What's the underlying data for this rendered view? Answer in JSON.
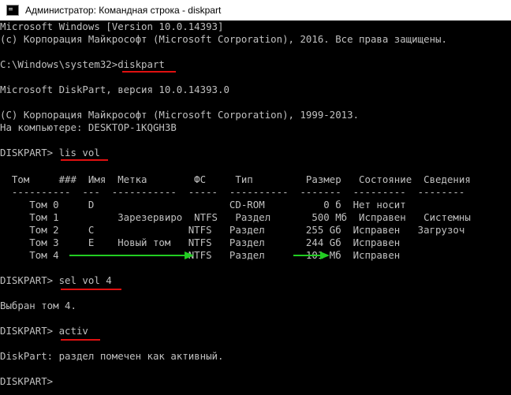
{
  "window": {
    "title": "Администратор: Командная строка - diskpart",
    "icon": "cmd-icon"
  },
  "console": {
    "lines": [
      "Microsoft Windows [Version 10.0.14393]",
      "(c) Корпорация Майкрософт (Microsoft Corporation), 2016. Все права защищены.",
      "",
      "C:\\Windows\\system32>diskpart",
      "",
      "Microsoft DiskPart, версия 10.0.14393.0",
      "",
      "(C) Корпорация Майкрософт (Microsoft Corporation), 1999-2013.",
      "На компьютере: DESKTOP-1KQGH3B",
      "",
      "DISKPART> lis vol",
      "",
      "  Том     ###  Имя  Метка        ФС     Тип         Размер   Состояние  Сведения",
      "  ----------  ---  -----------  -----  ----------  -------  ---------  --------",
      "     Том 0     D                       CD-ROM          0 б  Нет носит",
      "     Том 1          Зарезервиро  NTFS   Раздел       500 Мб  Исправен   Системны",
      "     Том 2     C                NTFS   Раздел       255 Gб  Исправен   Загрузоч",
      "     Том 3     E    Новый том   NTFS   Раздел       244 Gб  Исправен",
      "     Том 4                      NTFS   Раздел       101 Мб  Исправен",
      "",
      "DISKPART> sel vol 4",
      "",
      "Выбран том 4.",
      "",
      "DISKPART> activ",
      "",
      "DiskPart: раздел помечен как активный.",
      "",
      "DISKPART>"
    ]
  },
  "highlights": {
    "underline_color": "#e01010",
    "arrow_color": "#22cc22",
    "text_color": "#c0c0c0",
    "background_color": "#000000"
  }
}
